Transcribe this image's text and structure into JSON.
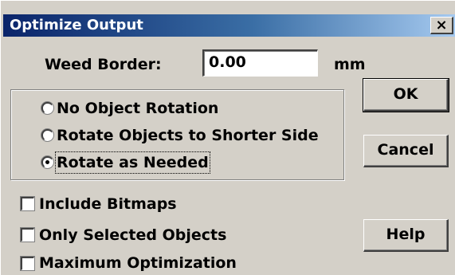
{
  "window": {
    "title": "Optimize Output",
    "close_glyph": "×"
  },
  "weed_border": {
    "label": "Weed Border:",
    "value": "0.00",
    "unit": "mm"
  },
  "rotation_group": {
    "options": [
      {
        "label": "No Object Rotation",
        "selected": false
      },
      {
        "label": "Rotate Objects to Shorter Side",
        "selected": false
      },
      {
        "label": "Rotate as Needed",
        "selected": true
      }
    ]
  },
  "checkboxes": [
    {
      "label": "Include Bitmaps",
      "checked": false
    },
    {
      "label": "Only Selected Objects",
      "checked": false
    },
    {
      "label": "Maximum Optimization",
      "checked": false
    }
  ],
  "buttons": {
    "ok": "OK",
    "cancel": "Cancel",
    "help": "Help"
  },
  "colors": {
    "title_bar_start": "#0a246a",
    "title_bar_end": "#a6caf0",
    "face": "#d4d0c8"
  }
}
